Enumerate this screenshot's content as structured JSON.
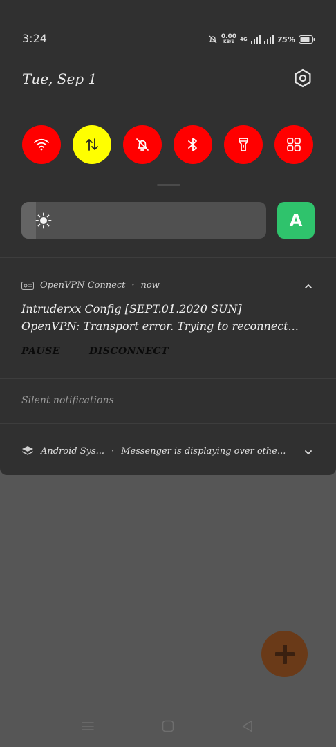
{
  "status_bar": {
    "time": "3:24",
    "net_speed_value": "0.00",
    "net_speed_unit": "KB/S",
    "network_type": "4G",
    "battery_percent": "75%"
  },
  "quick_settings": {
    "date": "Tue, Sep 1",
    "toggles": [
      {
        "name": "wifi",
        "icon": "wifi-icon",
        "color": "#ff0000"
      },
      {
        "name": "mobile-data",
        "icon": "data-arrows-icon",
        "color": "#ffff00"
      },
      {
        "name": "do-not-disturb",
        "icon": "bell-off-icon",
        "color": "#ff0000"
      },
      {
        "name": "bluetooth",
        "icon": "bluetooth-icon",
        "color": "#ff0000"
      },
      {
        "name": "flashlight",
        "icon": "flashlight-icon",
        "color": "#ff0000"
      },
      {
        "name": "more",
        "icon": "grid-icon",
        "color": "#ff0000"
      }
    ],
    "brightness_level": 0.06,
    "auto_brightness_label": "A",
    "accent": "#2fc36c"
  },
  "notifications": {
    "openvpn": {
      "app": "OpenVPN Connect",
      "time": "now",
      "title": "Intruderxx Config [SEPT.01.2020 SUN]",
      "text": "OpenVPN: Transport error. Trying to reconnect...",
      "actions": [
        "PAUSE",
        "DISCONNECT"
      ]
    },
    "silent_header": "Silent notifications",
    "android": {
      "app": "Android Sys...",
      "text": "Messenger is displaying over othe..."
    }
  }
}
